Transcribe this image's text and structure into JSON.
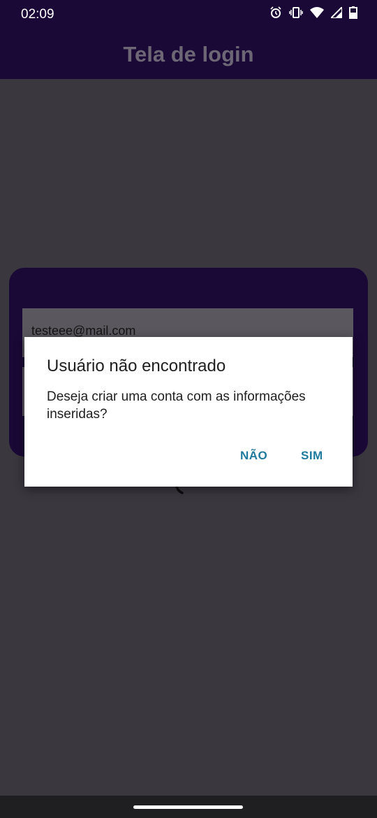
{
  "status_bar": {
    "time": "02:09",
    "icons": [
      "alarm-icon",
      "vibrate-icon",
      "wifi-icon",
      "signal-icon",
      "battery-icon"
    ]
  },
  "app_bar": {
    "title": "Tela de login"
  },
  "form": {
    "email_value": "testeee@mail.com"
  },
  "dialog": {
    "title": "Usuário não encontrado",
    "message": "Deseja criar uma conta com as informações inseridas?",
    "button_no": "NÃO",
    "button_yes": "SIM"
  },
  "colors": {
    "primary_dark": "#1a0836",
    "scrim_background": "#3a373f",
    "dialog_button": "#1f7a9e"
  }
}
